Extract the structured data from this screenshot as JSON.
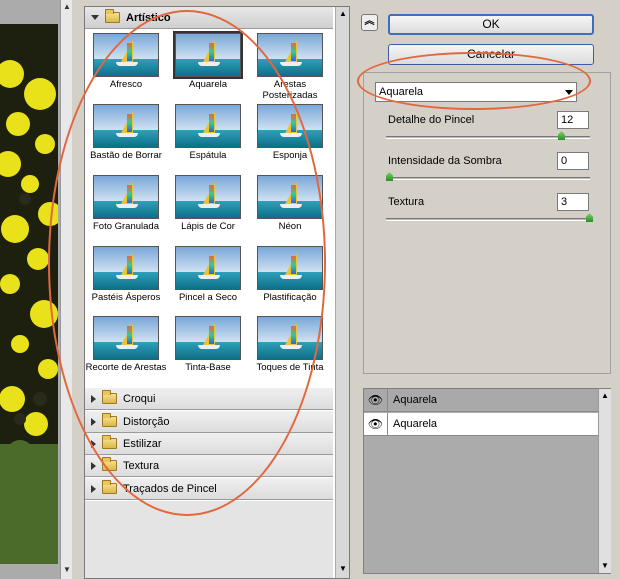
{
  "gallery": {
    "categories": [
      {
        "label": "Artístico",
        "expanded": true
      },
      {
        "label": "Croqui"
      },
      {
        "label": "Distorção"
      },
      {
        "label": "Estilizar"
      },
      {
        "label": "Textura"
      },
      {
        "label": "Traçados de Pincel"
      }
    ],
    "thumbnails": [
      {
        "label": "Afresco"
      },
      {
        "label": "Aquarela",
        "selected": true
      },
      {
        "label": "Arestas Posterizadas"
      },
      {
        "label": "Bastão de Borrar"
      },
      {
        "label": "Espátula"
      },
      {
        "label": "Esponja"
      },
      {
        "label": "Foto Granulada"
      },
      {
        "label": "Lápis de Cor"
      },
      {
        "label": "Néon"
      },
      {
        "label": "Pastéis Ásperos"
      },
      {
        "label": "Pincel a Seco"
      },
      {
        "label": "Plastificação"
      },
      {
        "label": "Recorte de Arestas"
      },
      {
        "label": "Tinta-Base"
      },
      {
        "label": "Toques de Tinta"
      }
    ]
  },
  "buttons": {
    "ok": "OK",
    "cancel": "Cancelar"
  },
  "filter_select": {
    "value": "Aquarela"
  },
  "params": [
    {
      "label": "Detalhe do Pincel",
      "value": "12",
      "level": 0.86
    },
    {
      "label": "Intensidade da Sombra",
      "value": "0",
      "level": 0.0
    },
    {
      "label": "Textura",
      "value": "3",
      "level": 1.0
    }
  ],
  "layers": [
    {
      "name": "Aquarela",
      "active": true
    },
    {
      "name": "Aquarela",
      "active": false
    }
  ],
  "colors": {
    "annotation": "#e2673e",
    "selected_layer": "#a9a9a9"
  }
}
